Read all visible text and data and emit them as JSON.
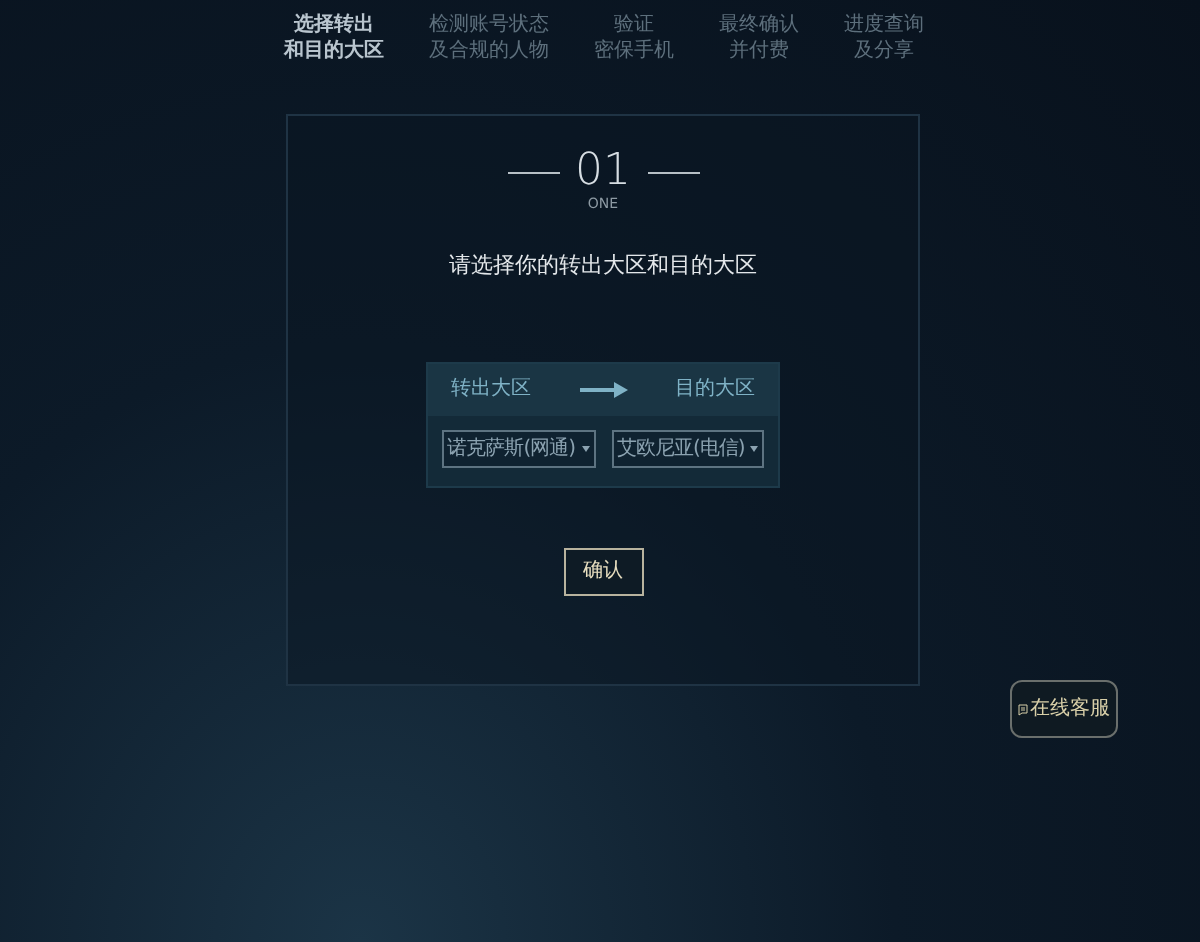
{
  "steps": [
    {
      "line1": "选择转出",
      "line2": "和目的大区",
      "selected": true
    },
    {
      "line1": "检测账号状态",
      "line2": "及合规的人物",
      "selected": false
    },
    {
      "line1": "验证",
      "line2": "密保手机",
      "selected": false
    },
    {
      "line1": "最终确认",
      "line2": "并付费",
      "selected": false
    },
    {
      "line1": "进度查询",
      "line2": "及分享",
      "selected": false
    }
  ],
  "panel": {
    "number": "01",
    "number_caption": "ONE",
    "heading": "请选择你的转出大区和目的大区",
    "from_label": "转出大区",
    "to_label": "目的大区",
    "from_value": "诺克萨斯(网通)",
    "to_value": "艾欧尼亚(电信)",
    "confirm": "确认"
  },
  "chat_button": "在线客服"
}
